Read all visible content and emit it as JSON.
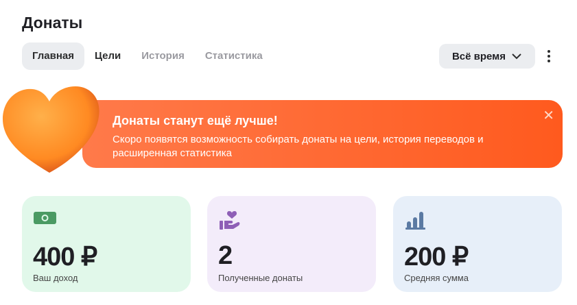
{
  "header": {
    "title": "Донаты",
    "period": "Всё время"
  },
  "tabs": [
    {
      "label": "Главная"
    },
    {
      "label": "Цели"
    },
    {
      "label": "История"
    },
    {
      "label": "Статистика"
    }
  ],
  "banner": {
    "title": "Донаты станут ещё лучше!",
    "text": "Скоро появятся возможность собирать донаты на цели, история переводов и расширенная статистика"
  },
  "stats": [
    {
      "value": "400 ₽",
      "label": "Ваш доход",
      "bg": "#e1f8ea",
      "icon_color": "#4a9a63"
    },
    {
      "value": "2",
      "label": "Полученные донаты",
      "bg": "#f3ecfa",
      "icon_color": "#8e5fb6"
    },
    {
      "value": "200 ₽",
      "label": "Средняя сумма",
      "bg": "#e7eff9",
      "icon_color": "#5b7aa3"
    }
  ]
}
